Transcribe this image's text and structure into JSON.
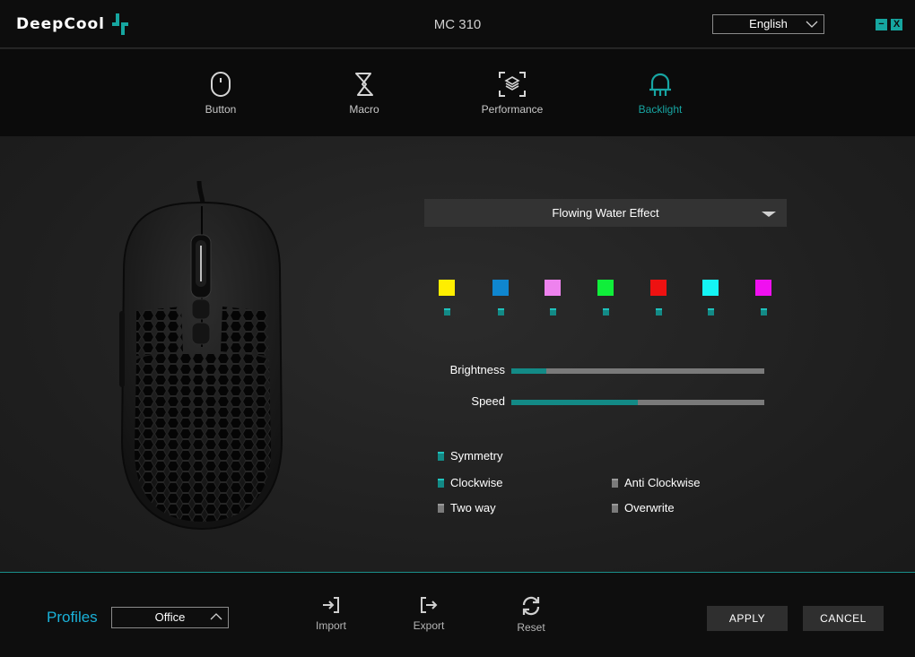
{
  "titlebar": {
    "brand": "DeepCool",
    "title": "MC 310",
    "language": "English",
    "minimize": "−",
    "close": "X"
  },
  "nav": {
    "items": [
      {
        "label": "Button",
        "icon": "mouse-icon",
        "active": false
      },
      {
        "label": "Macro",
        "icon": "macro-icon",
        "active": false
      },
      {
        "label": "Performance",
        "icon": "performance-icon",
        "active": false
      },
      {
        "label": "Backlight",
        "icon": "backlight-icon",
        "active": true
      }
    ]
  },
  "lighting": {
    "effect": "Flowing Water Effect",
    "colors": [
      "#ffee00",
      "#0f86cf",
      "#ee82ee",
      "#10ee3a",
      "#ee1111",
      "#14f4f4",
      "#f010f0"
    ],
    "brightness_label": "Brightness",
    "brightness_value": 0.14,
    "speed_label": "Speed",
    "speed_value": 0.5,
    "options": {
      "symmetry": {
        "label": "Symmetry",
        "checked": true
      },
      "clockwise": {
        "label": "Clockwise",
        "checked": true
      },
      "anti_clockwise": {
        "label": "Anti Clockwise",
        "checked": false
      },
      "two_way": {
        "label": "Two way",
        "checked": false
      },
      "overwrite": {
        "label": "Overwrite",
        "checked": false
      }
    }
  },
  "bottom": {
    "profiles_label": "Profiles",
    "profile_value": "Office",
    "import_label": "Import",
    "export_label": "Export",
    "reset_label": "Reset",
    "apply_label": "APPLY",
    "cancel_label": "CANCEL"
  },
  "colors": {
    "accent": "#17a5a2",
    "profiles": "#1ab1d8"
  }
}
